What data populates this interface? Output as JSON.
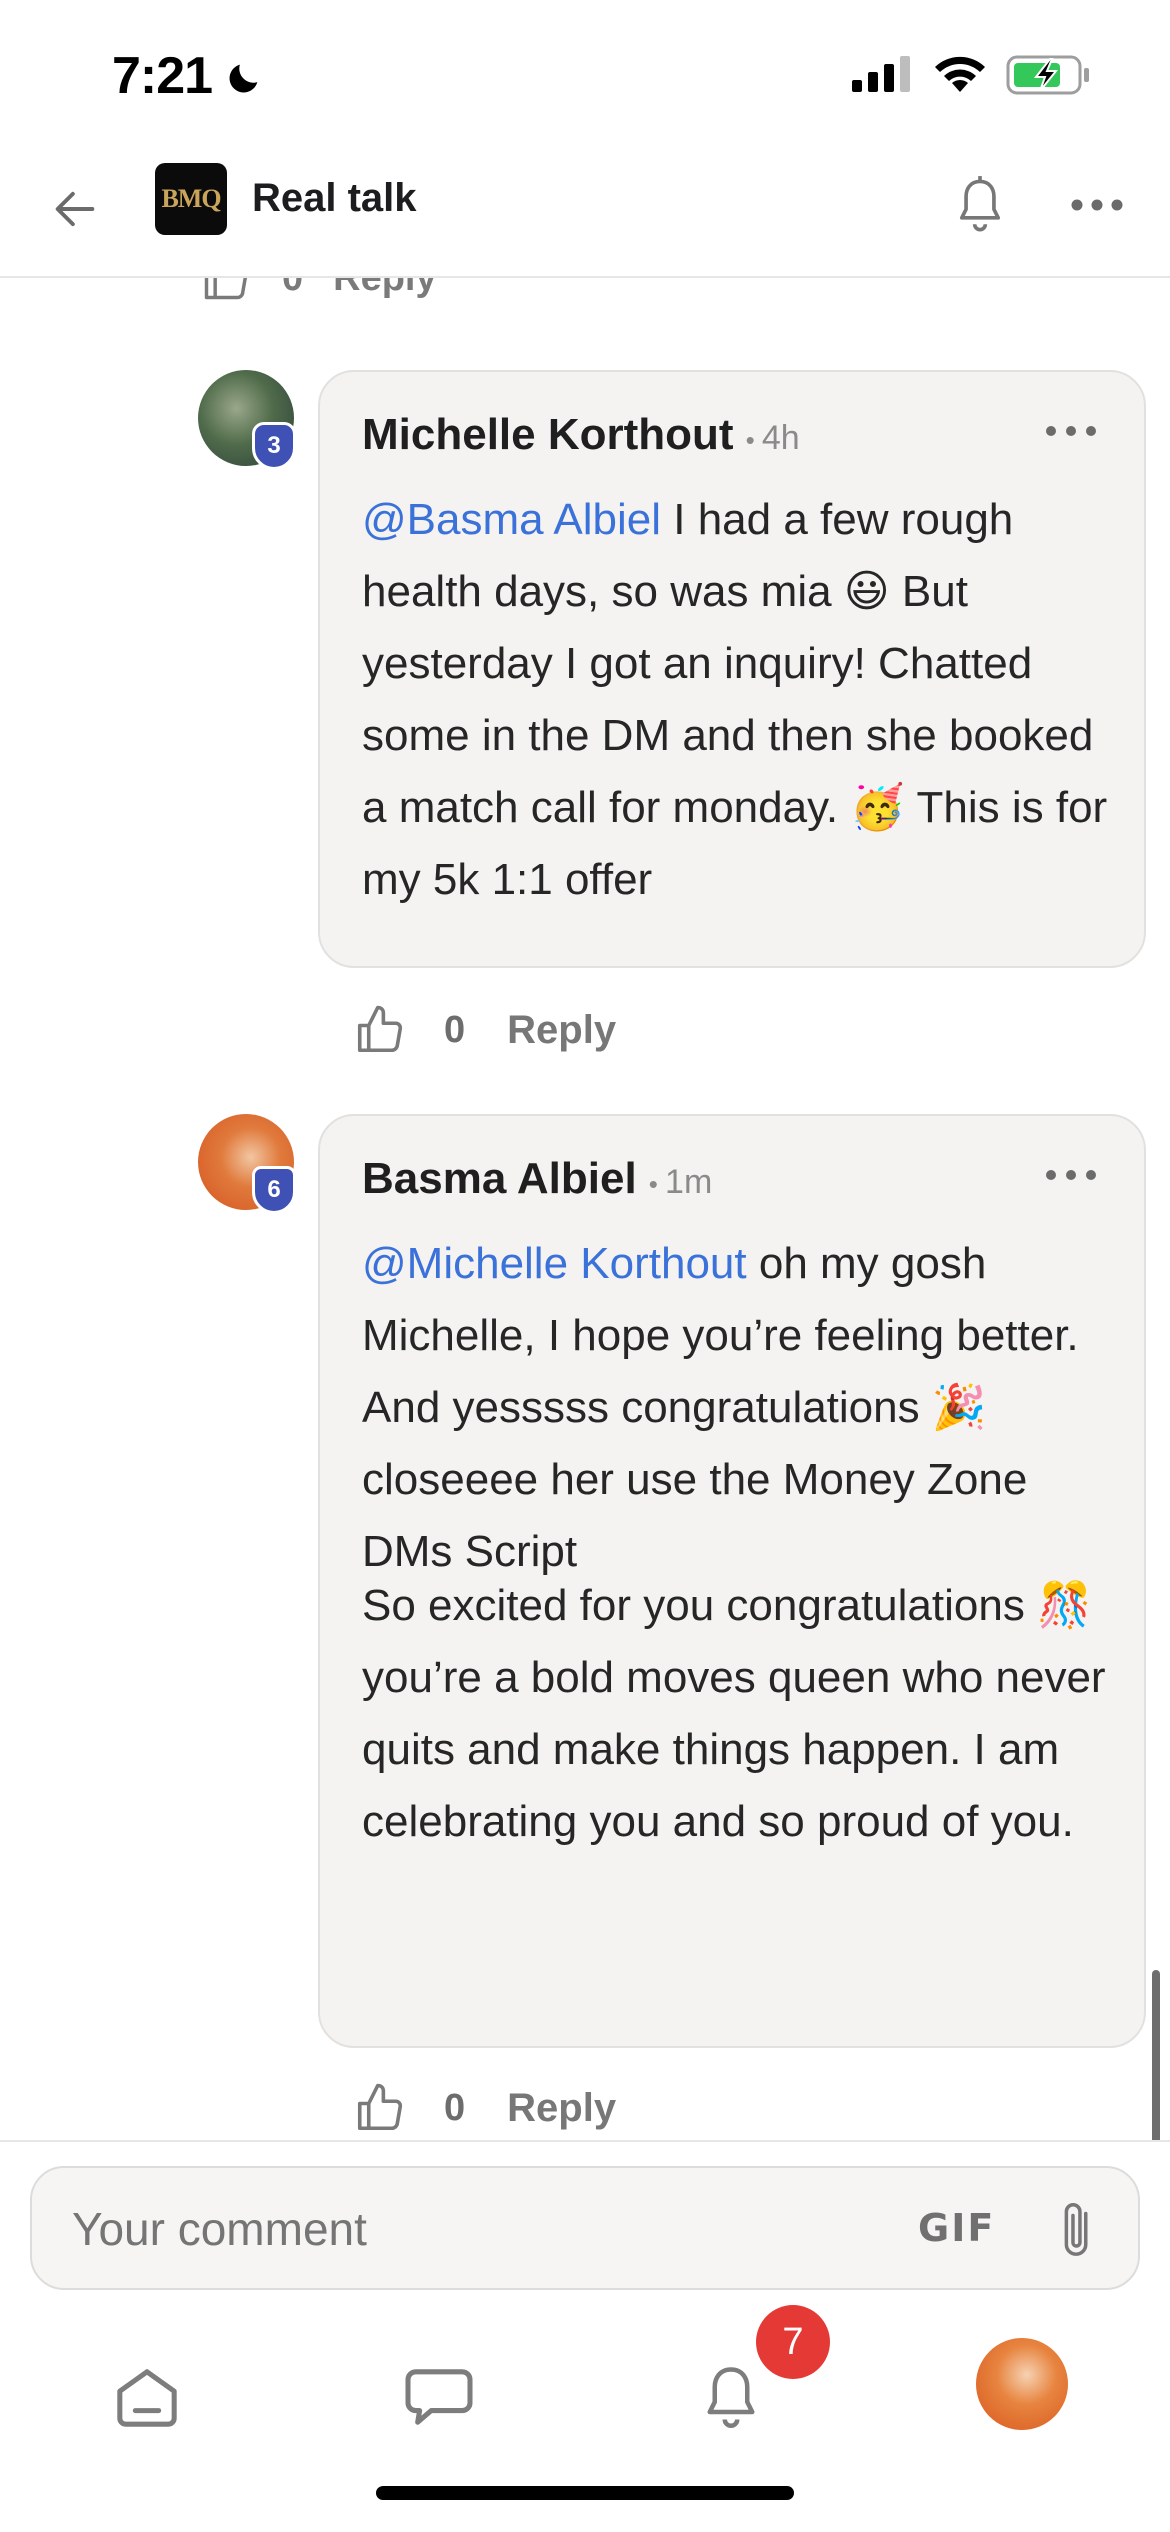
{
  "status_bar": {
    "time": "7:21",
    "icons": [
      "moon-icon",
      "signal-icon",
      "wifi-icon",
      "battery-charging-icon"
    ]
  },
  "header": {
    "back_icon": "arrow-left-icon",
    "group_logo_text": "BMQ",
    "title": "Real talk",
    "bell_icon": "bell-off-icon",
    "more_icon": "more-horizontal-icon"
  },
  "previous_comment_actions": {
    "like_count": "0",
    "reply_label": "Reply"
  },
  "comments": [
    {
      "author": "Michelle Korthout",
      "time": "4h",
      "level": "3",
      "mention": "@Basma Albiel",
      "text": " I had a few rough health days, so was mia 😃 But yesterday I got an inquiry! Chatted some in the DM and then she booked a match call for monday. 🥳 This is for my 5k 1:1 offer",
      "like_count": "0",
      "reply_label": "Reply"
    },
    {
      "author": "Basma Albiel",
      "time": "1m",
      "level": "6",
      "mention": "@Michelle Korthout",
      "text": " oh my gosh Michelle, I hope you’re feeling better. And yesssss congratulations 🎉 closeeee her use the Money Zone DMs Script",
      "text_2": "So excited for you congratulations 🎊 you’re a bold moves queen who never quits and make things happen. I am celebrating you and so proud of you.",
      "like_count": "0",
      "reply_label": "Reply"
    }
  ],
  "composer": {
    "placeholder": "Your comment",
    "gif_label": "GIF",
    "attach_icon": "paperclip-icon"
  },
  "bottom_nav": {
    "items": [
      "home-icon",
      "chat-icon",
      "bell-icon",
      "profile-avatar"
    ],
    "notification_count": "7"
  }
}
